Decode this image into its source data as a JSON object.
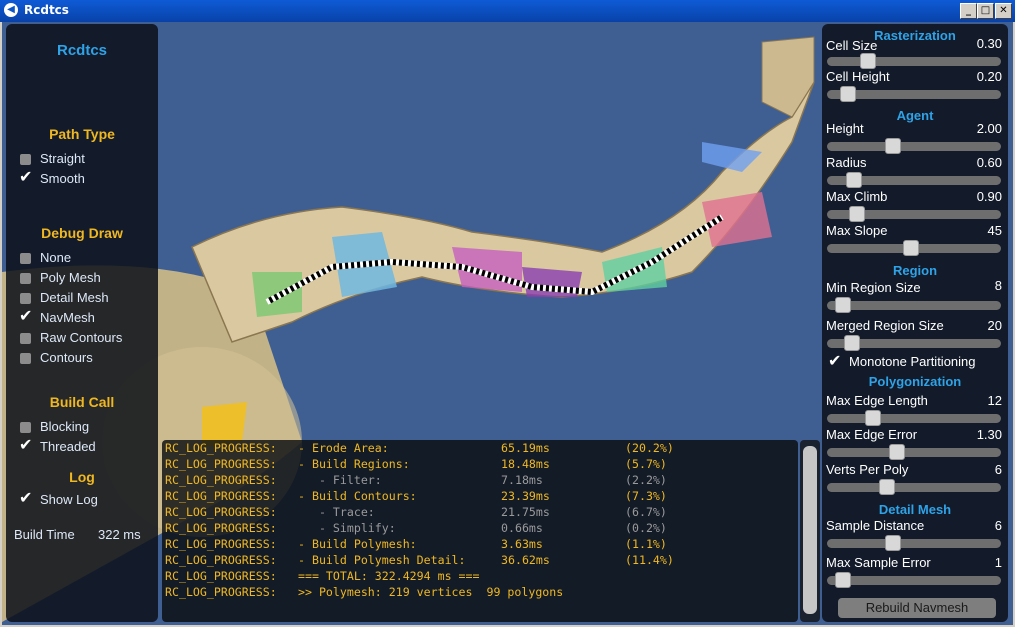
{
  "window": {
    "title": "Rcdtcs"
  },
  "left": {
    "app_title": "Rcdtcs",
    "path_type_heading": "Path Type",
    "path_type": [
      {
        "label": "Straight",
        "checked": false
      },
      {
        "label": "Smooth",
        "checked": true
      }
    ],
    "debug_draw_heading": "Debug Draw",
    "debug_draw": [
      {
        "label": "None",
        "checked": false
      },
      {
        "label": "Poly Mesh",
        "checked": false
      },
      {
        "label": "Detail Mesh",
        "checked": false
      },
      {
        "label": "NavMesh",
        "checked": true
      },
      {
        "label": "Raw Contours",
        "checked": false
      },
      {
        "label": "Contours",
        "checked": false
      }
    ],
    "build_call_heading": "Build Call",
    "build_call": [
      {
        "label": "Blocking",
        "checked": false
      },
      {
        "label": "Threaded",
        "checked": true
      }
    ],
    "log_heading": "Log",
    "show_log": {
      "label": "Show Log",
      "checked": true
    },
    "build_time_label": "Build Time",
    "build_time_value": "322 ms"
  },
  "right": {
    "rasterization_heading": "Rasterization",
    "cell_size": {
      "label": "Cell Size",
      "value": "0.30",
      "fraction": 0.21
    },
    "cell_height": {
      "label": "Cell Height",
      "value": "0.20",
      "fraction": 0.08
    },
    "agent_heading": "Agent",
    "height": {
      "label": "Height",
      "value": "2.00",
      "fraction": 0.37
    },
    "radius": {
      "label": "Radius",
      "value": "0.60",
      "fraction": 0.12
    },
    "max_climb": {
      "label": "Max Climb",
      "value": "0.90",
      "fraction": 0.14
    },
    "max_slope": {
      "label": "Max Slope",
      "value": "45",
      "fraction": 0.48
    },
    "region_heading": "Region",
    "min_region": {
      "label": "Min Region Size",
      "value": "8",
      "fraction": 0.05
    },
    "merged_region": {
      "label": "Merged Region Size",
      "value": "20",
      "fraction": 0.11
    },
    "monotone": {
      "label": "Monotone Partitioning",
      "checked": true
    },
    "polygonization_heading": "Polygonization",
    "max_edge_len": {
      "label": "Max Edge Length",
      "value": "12",
      "fraction": 0.24
    },
    "max_edge_err": {
      "label": "Max Edge Error",
      "value": "1.30",
      "fraction": 0.39
    },
    "verts_per_poly": {
      "label": "Verts Per Poly",
      "value": "6",
      "fraction": 0.33
    },
    "detail_heading": "Detail Mesh",
    "sample_distance": {
      "label": "Sample Distance",
      "value": "6",
      "fraction": 0.37
    },
    "max_sample_err": {
      "label": "Max Sample Error",
      "value": "1",
      "fraction": 0.05
    },
    "rebuild_label": "Rebuild Navmesh"
  },
  "log": [
    {
      "prefix": "RC_LOG_PROGRESS:",
      "name": "- Erode Area:",
      "time": "65.19ms",
      "pct": "(20.2%)",
      "dim": false
    },
    {
      "prefix": "RC_LOG_PROGRESS:",
      "name": "- Build Regions:",
      "time": "18.48ms",
      "pct": "(5.7%)",
      "dim": false
    },
    {
      "prefix": "RC_LOG_PROGRESS:",
      "name": "   - Filter:",
      "time": "7.18ms",
      "pct": "(2.2%)",
      "dim": true
    },
    {
      "prefix": "RC_LOG_PROGRESS:",
      "name": "- Build Contours:",
      "time": "23.39ms",
      "pct": "(7.3%)",
      "dim": false
    },
    {
      "prefix": "RC_LOG_PROGRESS:",
      "name": "   - Trace:",
      "time": "21.75ms",
      "pct": "(6.7%)",
      "dim": true
    },
    {
      "prefix": "RC_LOG_PROGRESS:",
      "name": "   - Simplify:",
      "time": "0.66ms",
      "pct": "(0.2%)",
      "dim": true
    },
    {
      "prefix": "RC_LOG_PROGRESS:",
      "name": "- Build Polymesh:",
      "time": "3.63ms",
      "pct": "(1.1%)",
      "dim": false
    },
    {
      "prefix": "RC_LOG_PROGRESS:",
      "name": "- Build Polymesh Detail:",
      "time": "36.62ms",
      "pct": "(11.4%)",
      "dim": false
    },
    {
      "prefix": "RC_LOG_PROGRESS:",
      "name": "=== TOTAL: 322.4294 ms ===",
      "time": "",
      "pct": "",
      "dim": false
    },
    {
      "prefix": "RC_LOG_PROGRESS:",
      "name": ">> Polymesh: 219 vertices  99 polygons",
      "time": "",
      "pct": "",
      "dim": false
    }
  ],
  "colors": {
    "accent_blue": "#2ea3e8",
    "accent_yellow": "#f0b820",
    "scene_bg": "#3f5f93",
    "mesh": "#d9c8a0"
  }
}
